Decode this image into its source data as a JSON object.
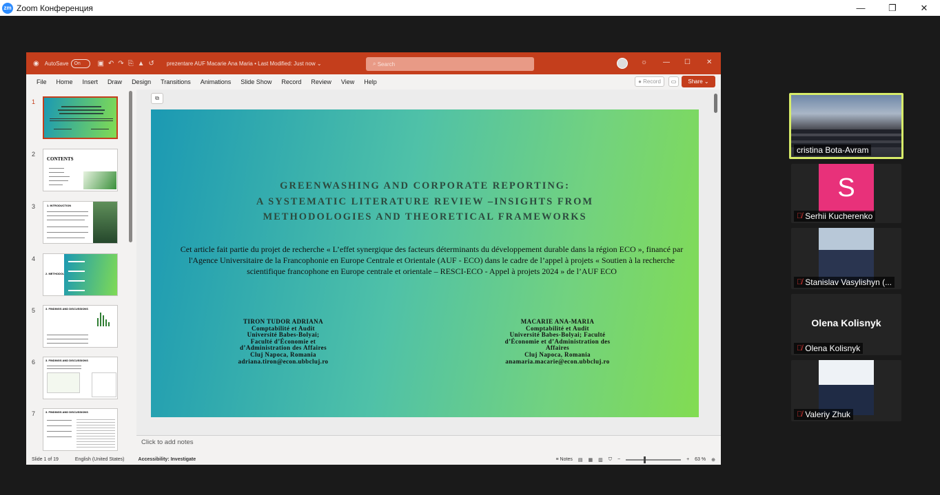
{
  "zoom": {
    "title": "Zoom Конференция",
    "logo_text": "zm",
    "minimize": "—",
    "restore": "❐",
    "close": "✕"
  },
  "ppt": {
    "autosave_label": "AutoSave",
    "autosave_state": "On",
    "doc_name": "prezentare AUF Macarie Ana Maria • Last Modified: Just now ⌄",
    "search_placeholder": "Search",
    "menu": [
      "File",
      "Home",
      "Insert",
      "Draw",
      "Design",
      "Transitions",
      "Animations",
      "Slide Show",
      "Record",
      "Review",
      "View",
      "Help"
    ],
    "record_label": "Record",
    "share_label": "Share ⌄",
    "thumbnails": [
      {
        "num": "1",
        "label": ""
      },
      {
        "num": "2",
        "label": "CONTENTS"
      },
      {
        "num": "3",
        "label": "1. INTRODUCTION"
      },
      {
        "num": "4",
        "label": "2. METHODOLOGY"
      },
      {
        "num": "5",
        "label": "3. FINDINGS AND DISCUSSIONS"
      },
      {
        "num": "6",
        "label": "3. FINDINGS AND DISCUSSIONS"
      },
      {
        "num": "7",
        "label": "3. FINDINGS AND DISCUSSIONS"
      }
    ],
    "slide": {
      "title": "GREENWASHING AND CORPORATE REPORTING:\nA SYSTEMATIC LITERATURE REVIEW –INSIGHTS FROM\nMETHODOLOGIES AND THEORETICAL FRAMEWORKS",
      "body": "Cet article fait partie du projet de recherche « L’effet synergique des facteurs déterminants du développement durable dans la région ECO », financé par l'Agence Universitaire de la Francophonie en Europe Centrale et Orientale (AUF - ECO) dans le cadre de l’appel à projets « Soutien à la recherche scientifique francophone en Europe centrale et orientale – RESCI-ECO - Appel à projets 2024 » de l’AUF ECO",
      "author1": [
        "TIRON TUDOR ADRIANA",
        "Comptabilité et Audit",
        "Université Babes-Bolyai; ",
        "Faculté d’Économie et ",
        "d’Administration des Affaires",
        "Cluj Napoca, Romania",
        "adriana.tiron@econ.ubbcluj.ro"
      ],
      "author2": [
        "MACARIE ANA-MARIA",
        "Comptabilité et Audit",
        "Université Babes-Bolyai; Faculté",
        "d’Économie et d’Administration des",
        "Affaires",
        "Cluj Napoca, Romania",
        "anamaria.macarie@econ.ubbcluj.ro"
      ]
    },
    "notes_placeholder": "Click to add notes",
    "status": {
      "slide": "Slide 1 of 19",
      "language": "English (United States)",
      "accessibility": "Accessibility: Investigate",
      "notes": "Notes",
      "zoom": "63 %"
    }
  },
  "participants": [
    {
      "name": "cristina Bota-Avram",
      "muted": false,
      "type": "camera"
    },
    {
      "name": "Serhii Kucherenko",
      "muted": true,
      "type": "avatar",
      "initial": "S"
    },
    {
      "name": "Stanislav Vasylishyn (...",
      "muted": true,
      "type": "photo"
    },
    {
      "name": "Olena Kolisnyk",
      "muted": true,
      "type": "name",
      "big_name": "Olena Kolisnyk"
    },
    {
      "name": "Valeriy Zhuk",
      "muted": true,
      "type": "photo"
    }
  ],
  "colors": {
    "ppt_accent": "#c43e1c",
    "zoom_blue": "#2d8cff",
    "active_speaker": "#d8ec6a",
    "avatar_pink": "#e8317a"
  }
}
